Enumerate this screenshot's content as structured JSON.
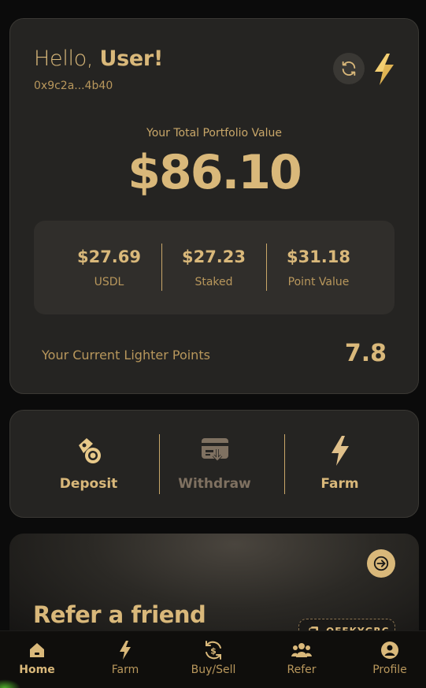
{
  "header": {
    "greeting_prefix": "Hello,",
    "user_name": "User!",
    "wallet_address": "0x9c2a...4b40"
  },
  "portfolio": {
    "label": "Your Total Portfolio Value",
    "value": "$86.10",
    "stats": [
      {
        "value": "$27.69",
        "label": "USDL"
      },
      {
        "value": "$27.23",
        "label": "Staked"
      },
      {
        "value": "$31.18",
        "label": "Point Value"
      }
    ],
    "points_label": "Your Current Lighter Points",
    "points_value": "7.8"
  },
  "actions": [
    {
      "label": "Deposit",
      "icon": "deposit-icon",
      "enabled": true
    },
    {
      "label": "Withdraw",
      "icon": "withdraw-icon",
      "enabled": false
    },
    {
      "label": "Farm",
      "icon": "bolt-icon",
      "enabled": true
    }
  ],
  "refer": {
    "title": "Refer a friend",
    "code": "QEEKYGRC"
  },
  "nav": [
    {
      "label": "Home",
      "icon": "home-icon",
      "active": true
    },
    {
      "label": "Farm",
      "icon": "bolt-icon",
      "active": false
    },
    {
      "label": "Buy/Sell",
      "icon": "exchange-icon",
      "active": false
    },
    {
      "label": "Refer",
      "icon": "group-icon",
      "active": false
    },
    {
      "label": "Profile",
      "icon": "user-icon",
      "active": false
    }
  ],
  "colors": {
    "background": "#0b0b0b",
    "card": "#252422",
    "accent": "#d9b87a",
    "muted_accent": "#b8975c",
    "disabled": "#7f7161"
  }
}
